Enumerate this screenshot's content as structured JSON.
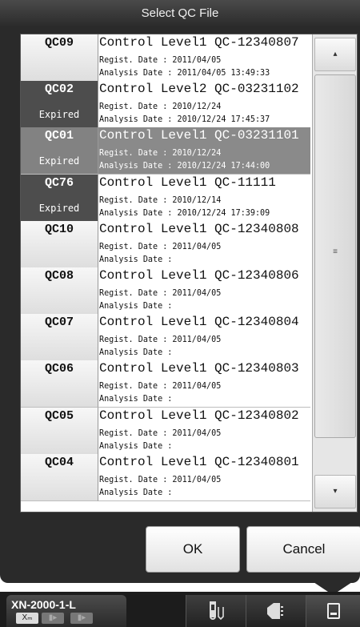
{
  "dialog": {
    "title": "Select QC File",
    "ok_label": "OK",
    "cancel_label": "Cancel"
  },
  "rows": [
    {
      "id": "QC09",
      "status": "",
      "name": "Control Level1 QC-12340807",
      "regist": "Regist. Date : 2011/04/05",
      "analysis": "Analysis Date : 2011/04/05 13:49:33",
      "state": "normal"
    },
    {
      "id": "QC02",
      "status": "Expired",
      "name": "Control Level2 QC-03231102",
      "regist": "Regist. Date : 2010/12/24",
      "analysis": "Analysis Date : 2010/12/24 17:45:37",
      "state": "expired"
    },
    {
      "id": "QC01",
      "status": "Expired",
      "name": "Control Level1 QC-03231101",
      "regist": "Regist. Date : 2010/12/24",
      "analysis": "Analysis Date : 2010/12/24 17:44:00",
      "state": "selected"
    },
    {
      "id": "QC76",
      "status": "Expired",
      "name": "Control Level1 QC-11111",
      "regist": "Regist. Date : 2010/12/14",
      "analysis": "Analysis Date : 2010/12/24 17:39:09",
      "state": "expired"
    },
    {
      "id": "QC10",
      "status": "",
      "name": "Control Level1 QC-12340808",
      "regist": "Regist. Date : 2011/04/05",
      "analysis": "Analysis Date :",
      "state": "normal"
    },
    {
      "id": "QC08",
      "status": "",
      "name": "Control Level1 QC-12340806",
      "regist": "Regist. Date : 2011/04/05",
      "analysis": "Analysis Date :",
      "state": "normal"
    },
    {
      "id": "QC07",
      "status": "",
      "name": "Control Level1 QC-12340804",
      "regist": "Regist. Date : 2011/04/05",
      "analysis": "Analysis Date :",
      "state": "normal"
    },
    {
      "id": "QC06",
      "status": "",
      "name": "Control Level1 QC-12340803",
      "regist": "Regist. Date : 2011/04/05",
      "analysis": "Analysis Date :",
      "state": "normal"
    },
    {
      "id": "QC05",
      "status": "",
      "name": "Control Level1 QC-12340802",
      "regist": "Regist. Date : 2011/04/05",
      "analysis": "Analysis Date :",
      "state": "normal"
    },
    {
      "id": "QC04",
      "status": "",
      "name": "Control Level1 QC-12340801",
      "regist": "Regist. Date : 2011/04/05",
      "analysis": "Analysis Date :",
      "state": "normal"
    }
  ],
  "taskbar": {
    "device_name": "XN-2000-1-L",
    "mode_1": "Xₘ",
    "mode_2": "▮▸",
    "mode_3": "▮▸",
    "icons": [
      "test-tube-icon",
      "analyzer-icon",
      "file-icon"
    ]
  },
  "colors": {
    "title_bg": "#2a2a2a",
    "expired_bg": "#4d4d4d",
    "selected_bg": "#8a8a8a"
  }
}
